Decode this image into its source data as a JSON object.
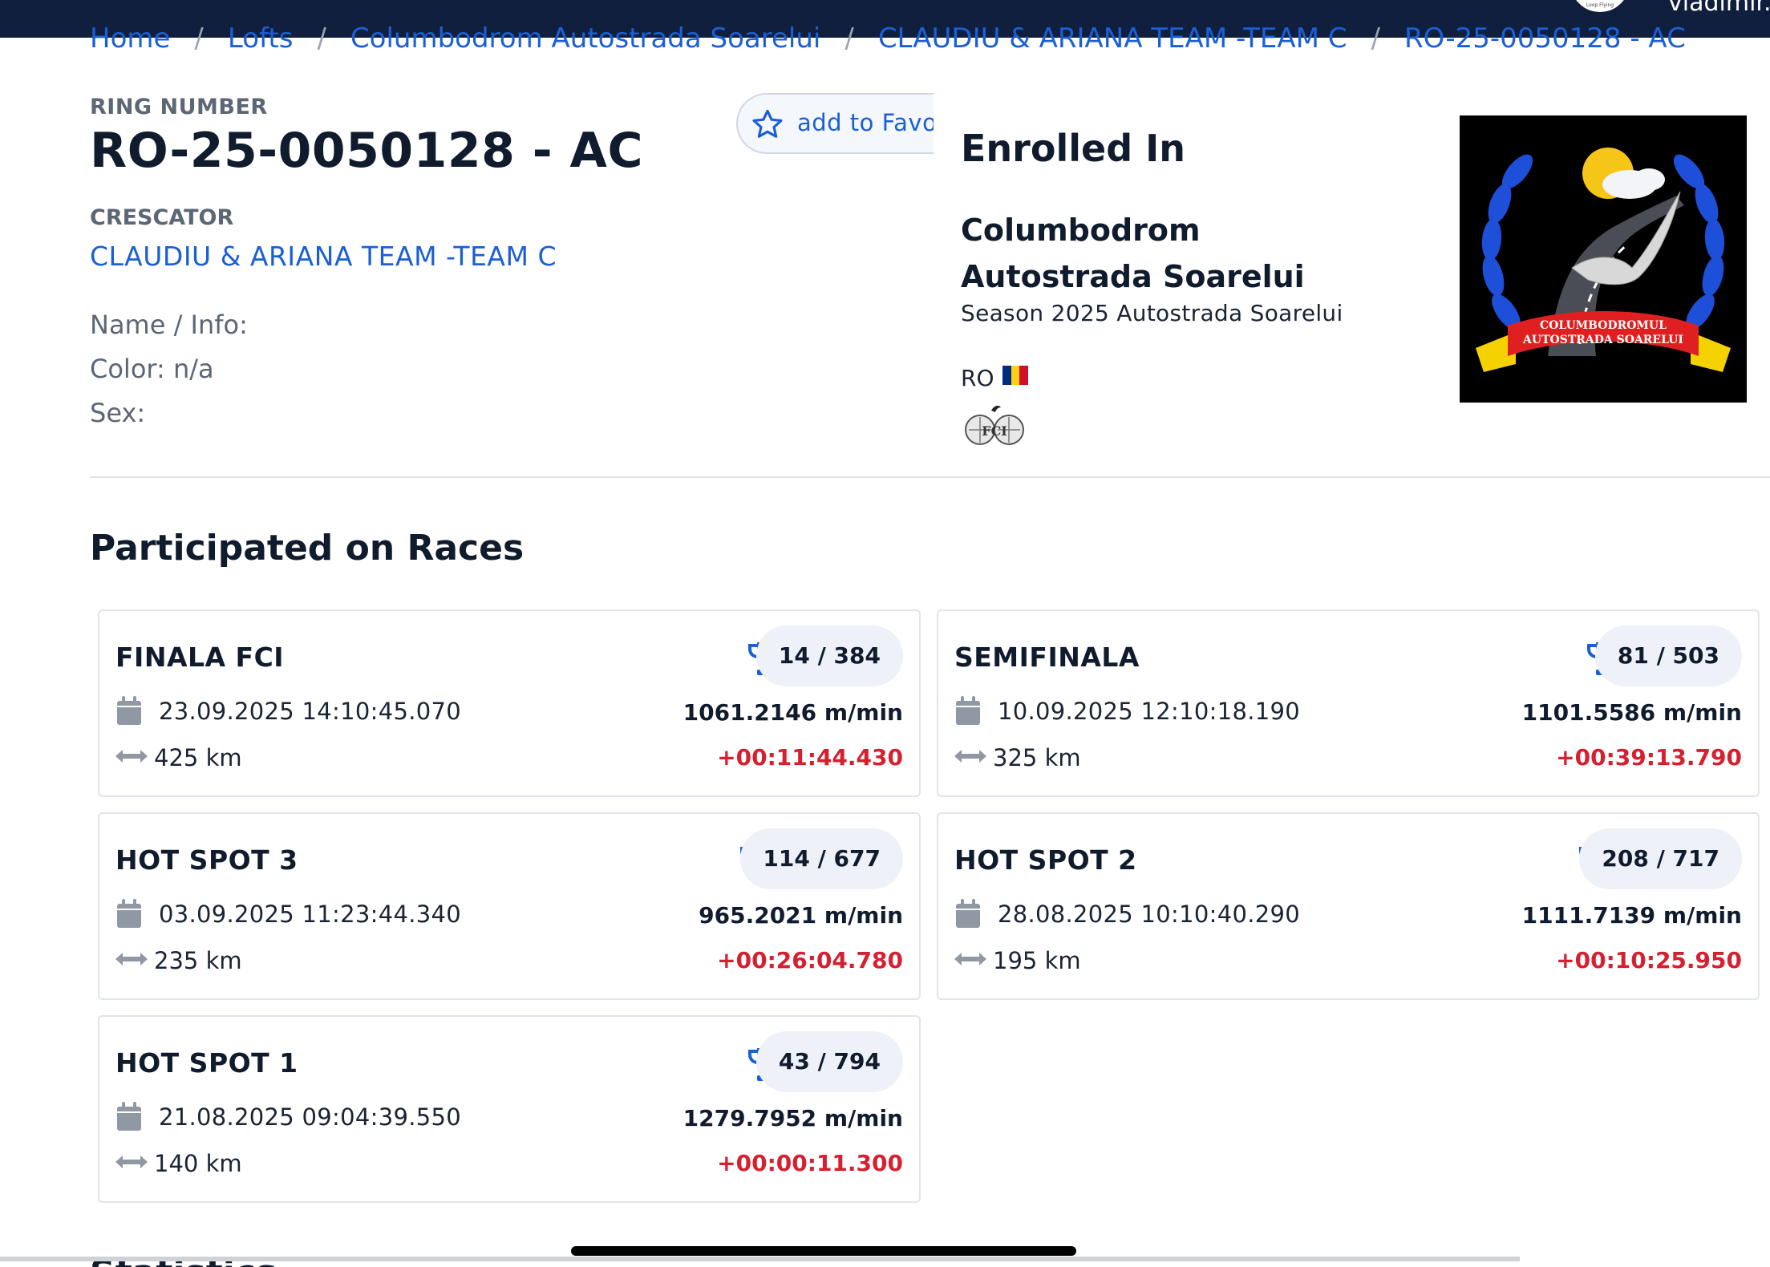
{
  "topbar": {
    "user_name": "vladimir.n",
    "avatar_caption": "Loop Flying"
  },
  "breadcrumb": [
    "Home",
    "Lofts",
    "Columbodrom Autostrada Soarelui",
    "CLAUDIU & ARIANA TEAM -TEAM C",
    "RO-25-0050128 - AC"
  ],
  "pigeon": {
    "ring_label": "RING NUMBER",
    "ring_number": "RO-25-0050128 - AC",
    "breeder_label": "CRESCATOR",
    "breeder_name": "CLAUDIU & ARIANA TEAM -TEAM C",
    "name_info": "Name / Info:",
    "color": "Color: n/a",
    "sex": "Sex:"
  },
  "favorite": {
    "label": "add to Favor"
  },
  "enrollment": {
    "title": "Enrolled In",
    "club": "Columbodrom Autostrada Soarelui",
    "season": "Season 2025 Autostrada Soarelui",
    "country": "RO",
    "flag_colors": [
      "#002b7f",
      "#fcd116",
      "#ce1126"
    ],
    "logo_text_line1": "COLUMBODROMUL",
    "logo_text_line2": "AUTOSTRADA SOARELUI"
  },
  "races_section": {
    "title": "Participated on Races",
    "races": [
      {
        "name": "FINALA FCI",
        "date": "23.09.2025 14:10:45.070",
        "distance": "425 km",
        "rank": "14 / 384",
        "speed": "1061.2146 m/min",
        "delay": "+00:11:44.430"
      },
      {
        "name": "SEMIFINALA",
        "date": "10.09.2025 12:10:18.190",
        "distance": "325 km",
        "rank": "81 / 503",
        "speed": "1101.5586 m/min",
        "delay": "+00:39:13.790"
      },
      {
        "name": "HOT SPOT 3",
        "date": "03.09.2025 11:23:44.340",
        "distance": "235 km",
        "rank": "114 / 677",
        "speed": "965.2021 m/min",
        "delay": "+00:26:04.780"
      },
      {
        "name": "HOT SPOT 2",
        "date": "28.08.2025 10:10:40.290",
        "distance": "195 km",
        "rank": "208 / 717",
        "speed": "1111.7139 m/min",
        "delay": "+00:10:25.950"
      },
      {
        "name": "HOT SPOT 1",
        "date": "21.08.2025 09:04:39.550",
        "distance": "140 km",
        "rank": "43 / 794",
        "speed": "1279.7952 m/min",
        "delay": "+00:00:11.300"
      }
    ]
  },
  "next_section": {
    "title": "Statistics"
  },
  "icons": {
    "star": "star-icon",
    "trophy": "trophy-icon",
    "calendar": "calendar-icon",
    "distance": "arrows-horizontal-icon"
  },
  "colors": {
    "navbar": "#0f1f3d",
    "link": "#1a5fd6",
    "trophy": "#1a5fd6",
    "delay": "#d6202f",
    "heading": "#101c2e"
  }
}
